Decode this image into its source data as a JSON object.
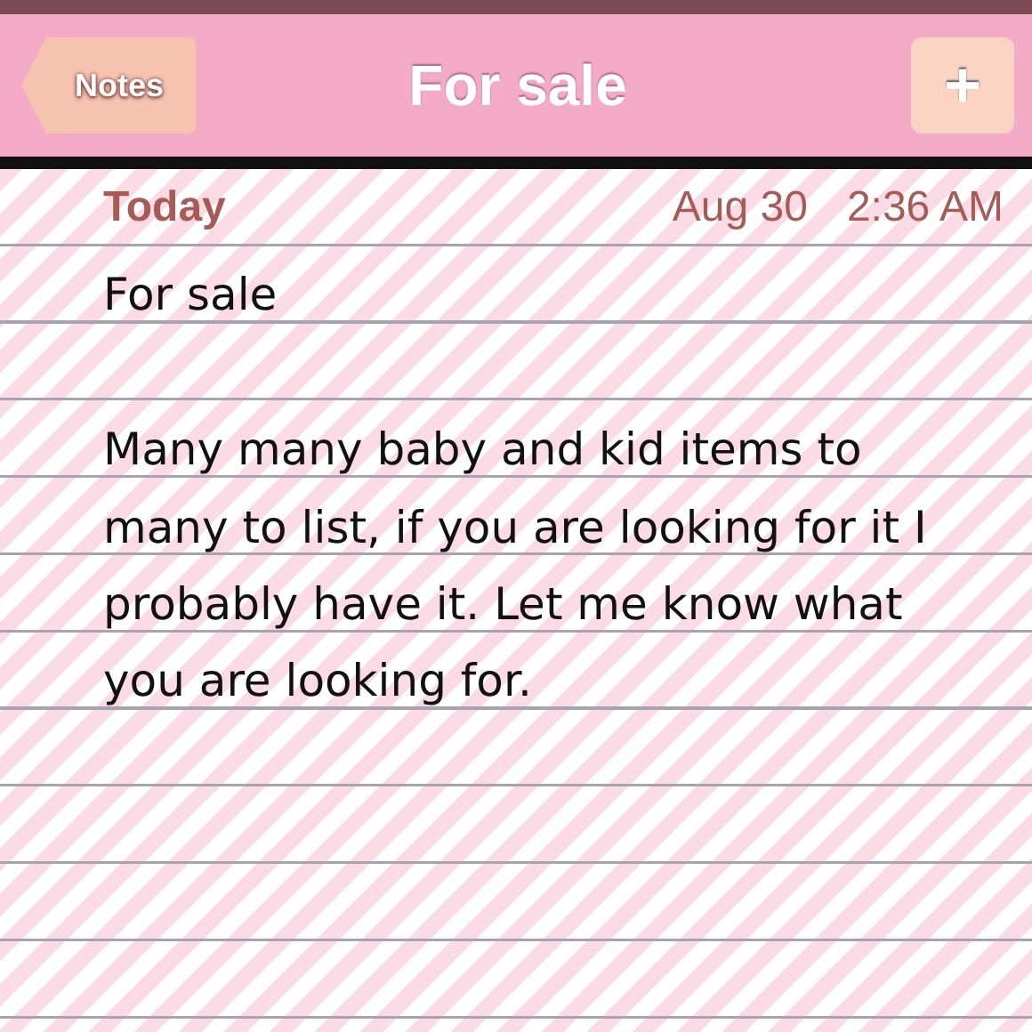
{
  "nav_bar": {
    "back_button": "Notes",
    "title": "For sale",
    "add_button": "+"
  },
  "note": {
    "day": "Today",
    "date": "Aug 30",
    "time": "2:36 AM",
    "title_line": "For sale",
    "body": "Many many baby and kid items to many to list, if you are looking for it I probably have it. Let me know what you are looking for."
  }
}
